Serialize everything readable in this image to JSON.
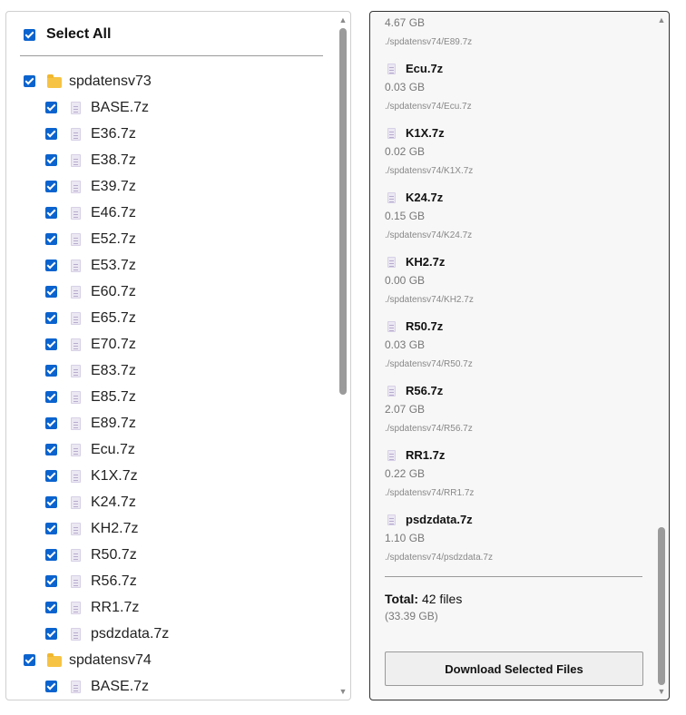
{
  "tree": {
    "select_all_label": "Select All",
    "items": [
      {
        "kind": "folder",
        "name": "spdatensv73"
      },
      {
        "kind": "file",
        "name": "BASE.7z"
      },
      {
        "kind": "file",
        "name": "E36.7z"
      },
      {
        "kind": "file",
        "name": "E38.7z"
      },
      {
        "kind": "file",
        "name": "E39.7z"
      },
      {
        "kind": "file",
        "name": "E46.7z"
      },
      {
        "kind": "file",
        "name": "E52.7z"
      },
      {
        "kind": "file",
        "name": "E53.7z"
      },
      {
        "kind": "file",
        "name": "E60.7z"
      },
      {
        "kind": "file",
        "name": "E65.7z"
      },
      {
        "kind": "file",
        "name": "E70.7z"
      },
      {
        "kind": "file",
        "name": "E83.7z"
      },
      {
        "kind": "file",
        "name": "E85.7z"
      },
      {
        "kind": "file",
        "name": "E89.7z"
      },
      {
        "kind": "file",
        "name": "Ecu.7z"
      },
      {
        "kind": "file",
        "name": "K1X.7z"
      },
      {
        "kind": "file",
        "name": "K24.7z"
      },
      {
        "kind": "file",
        "name": "KH2.7z"
      },
      {
        "kind": "file",
        "name": "R50.7z"
      },
      {
        "kind": "file",
        "name": "R56.7z"
      },
      {
        "kind": "file",
        "name": "RR1.7z"
      },
      {
        "kind": "file",
        "name": "psdzdata.7z"
      },
      {
        "kind": "folder",
        "name": "spdatensv74"
      },
      {
        "kind": "file",
        "name": "BASE.7z"
      }
    ]
  },
  "summary": {
    "files": [
      {
        "name": "",
        "size": "4.67 GB",
        "path": "./spdatensv74/E89.7z"
      },
      {
        "name": "Ecu.7z",
        "size": "0.03 GB",
        "path": "./spdatensv74/Ecu.7z"
      },
      {
        "name": "K1X.7z",
        "size": "0.02 GB",
        "path": "./spdatensv74/K1X.7z"
      },
      {
        "name": "K24.7z",
        "size": "0.15 GB",
        "path": "./spdatensv74/K24.7z"
      },
      {
        "name": "KH2.7z",
        "size": "0.00 GB",
        "path": "./spdatensv74/KH2.7z"
      },
      {
        "name": "R50.7z",
        "size": "0.03 GB",
        "path": "./spdatensv74/R50.7z"
      },
      {
        "name": "R56.7z",
        "size": "2.07 GB",
        "path": "./spdatensv74/R56.7z"
      },
      {
        "name": "RR1.7z",
        "size": "0.22 GB",
        "path": "./spdatensv74/RR1.7z"
      },
      {
        "name": "psdzdata.7z",
        "size": "1.10 GB",
        "path": "./spdatensv74/psdzdata.7z"
      }
    ],
    "total_label": "Total:",
    "total_count": "42 files",
    "total_size": "(33.39 GB)",
    "download_label": "Download Selected Files"
  },
  "colors": {
    "checkbox": "#0b63ce",
    "folder": "#f6c344"
  },
  "icons": {
    "folder": "folder-icon",
    "file": "file-icon",
    "scroll_up": "scroll-up-arrow",
    "scroll_down": "scroll-down-arrow"
  }
}
